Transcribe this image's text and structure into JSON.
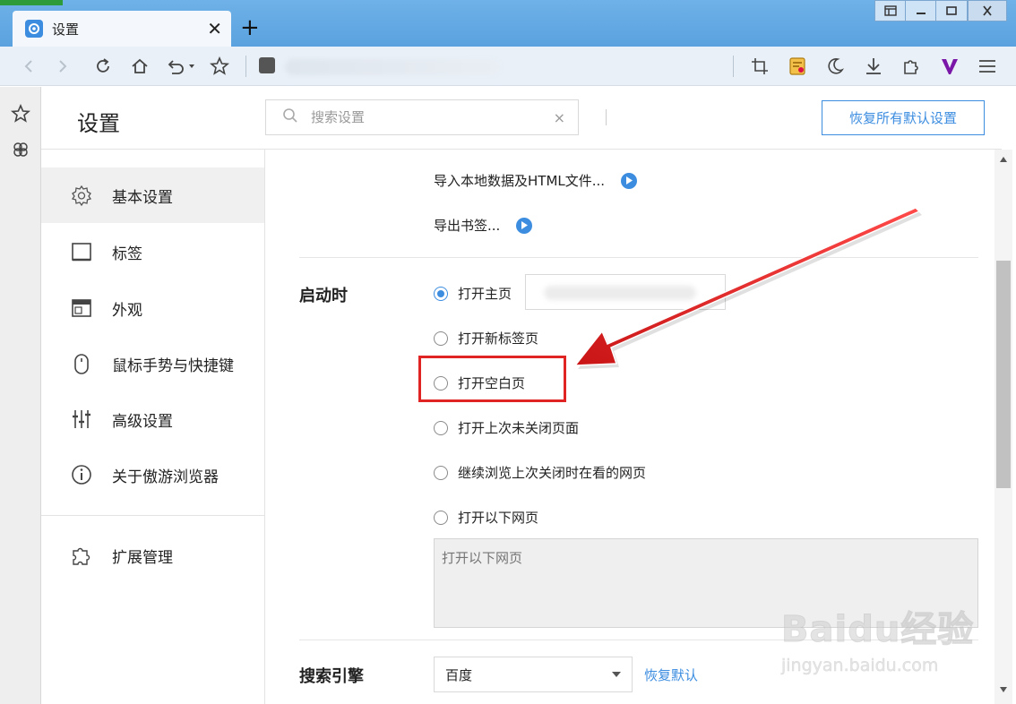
{
  "window": {
    "tab_title": "设置",
    "new_tab_symbol": "+",
    "tab_close_symbol": "✕"
  },
  "settings": {
    "page_title": "设置",
    "search": {
      "placeholder": "搜索设置",
      "value": ""
    },
    "search_clear_symbol": "×",
    "restore_all_label": "恢复所有默认设置"
  },
  "nav": {
    "items": [
      {
        "label": "基本设置",
        "icon": "gear-icon",
        "active": true
      },
      {
        "label": "标签",
        "icon": "tab-icon"
      },
      {
        "label": "外观",
        "icon": "window-icon"
      },
      {
        "label": "鼠标手势与快捷键",
        "icon": "mouse-icon"
      },
      {
        "label": "高级设置",
        "icon": "sliders-icon"
      },
      {
        "label": "关于傲游浏览器",
        "icon": "info-icon"
      },
      {
        "label": "扩展管理",
        "icon": "puzzle-icon"
      }
    ]
  },
  "content": {
    "import_link": "导入本地数据及HTML文件...",
    "export_link": "导出书签...",
    "startup": {
      "title": "启动时",
      "options": [
        {
          "label": "打开主页",
          "checked": true
        },
        {
          "label": "打开新标签页",
          "checked": false
        },
        {
          "label": "打开空白页",
          "checked": false
        },
        {
          "label": "打开上次未关闭页面",
          "checked": false
        },
        {
          "label": "继续浏览上次关闭时在看的网页",
          "checked": false
        },
        {
          "label": "打开以下网页",
          "checked": false
        }
      ],
      "urls_placeholder": "打开以下网页"
    },
    "search_engine": {
      "title": "搜索引擎",
      "selected": "百度",
      "restore_label": "恢复默认"
    }
  },
  "annotation": {
    "color": "#e02424"
  },
  "watermark": {
    "logo": "Baidu经验",
    "url": "jingyan.baidu.com"
  },
  "colors": {
    "accent": "#3c8de0",
    "titlebar": "#5aa2df"
  }
}
